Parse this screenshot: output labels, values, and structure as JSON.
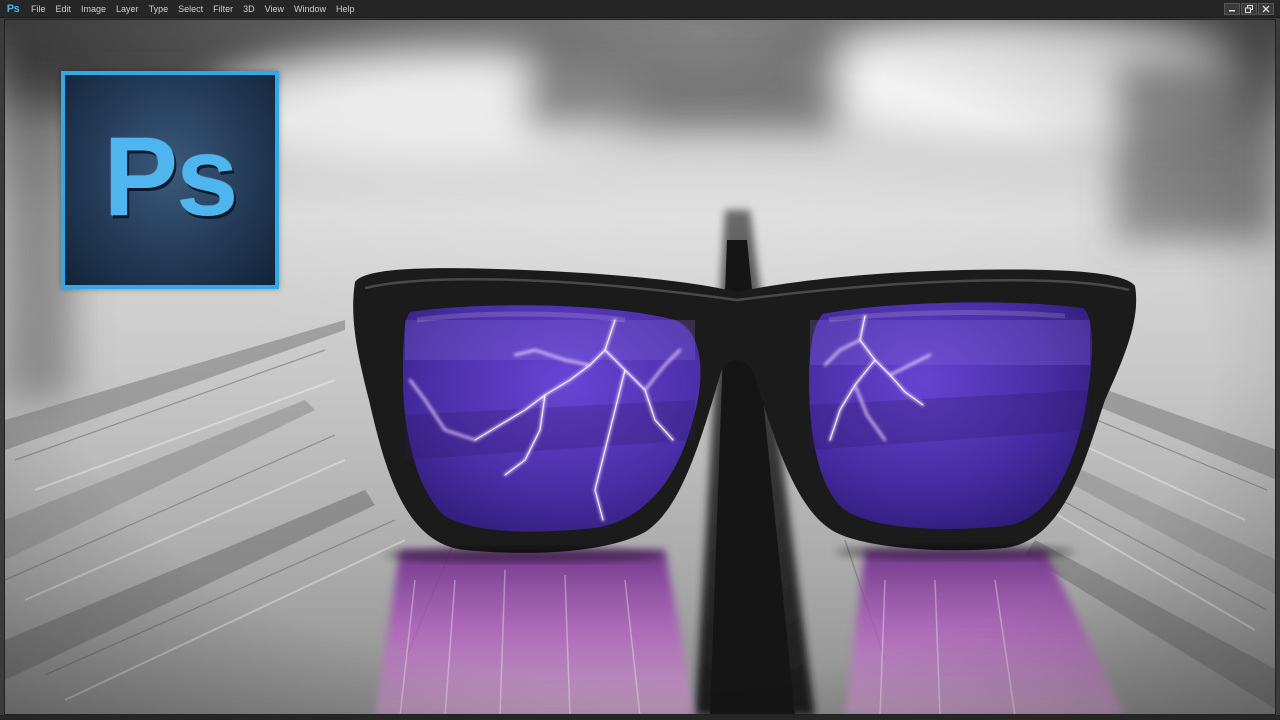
{
  "app": {
    "icon_label": "Ps"
  },
  "menu": {
    "items": [
      "File",
      "Edit",
      "Image",
      "Layer",
      "Type",
      "Select",
      "Filter",
      "3D",
      "View",
      "Window",
      "Help"
    ]
  },
  "window_controls": {
    "icons": [
      "minimize-icon",
      "restore-icon",
      "close-icon"
    ]
  },
  "logo": {
    "text": "Ps",
    "border_color": "#31a8e8",
    "text_color": "#4fb5ee",
    "bg_color": "#233a56"
  },
  "artwork": {
    "lens_color": "#4a2fa8",
    "reflection_color": "#b45cc2",
    "frame_color": "#1b1b1b"
  }
}
